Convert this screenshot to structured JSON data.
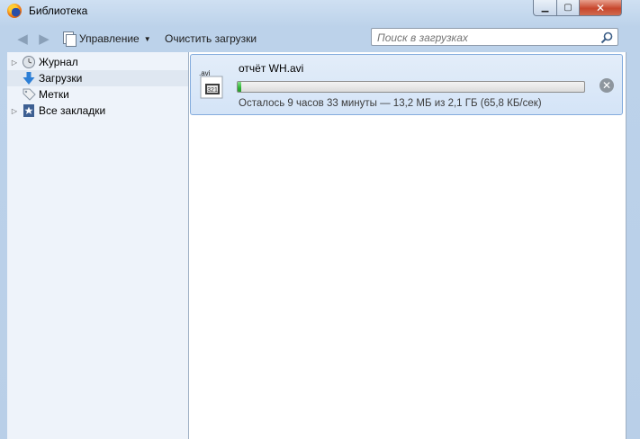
{
  "window": {
    "title": "Библиотека"
  },
  "toolbar": {
    "organize_label": "Управление",
    "clear_downloads_label": "Очистить загрузки",
    "search_placeholder": "Поиск в загрузках"
  },
  "sidebar": {
    "items": [
      {
        "label": "Журнал",
        "icon": "history-clock-icon",
        "expandable": true
      },
      {
        "label": "Загрузки",
        "icon": "download-arrow-icon",
        "expandable": false,
        "selected": true
      },
      {
        "label": "Метки",
        "icon": "tag-icon",
        "expandable": false
      },
      {
        "label": "Все закладки",
        "icon": "bookmarks-star-icon",
        "expandable": true
      }
    ]
  },
  "downloads": [
    {
      "file_name": "отчёт WH.avi",
      "icon_ext": ".avi",
      "status": "Осталось 9 часов 33 минуты — 13,2 МБ из 2,1 ГБ (65,8 КБ/сек)",
      "progress_fraction": 0.006
    }
  ],
  "colors": {
    "selection_bg": "#d4e4f7",
    "selection_border": "#84acdd",
    "progress_green": "#2fb336"
  }
}
